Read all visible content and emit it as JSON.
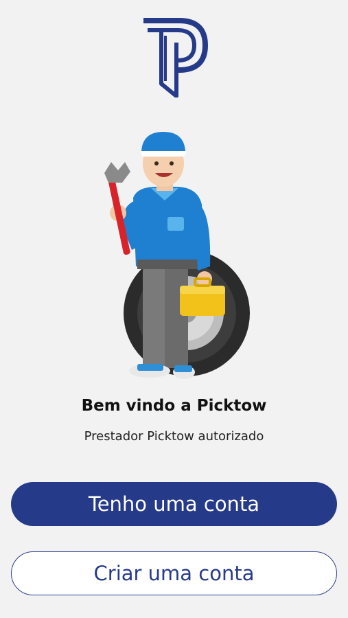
{
  "brand": {
    "logo_icon": "picktow-p-logo-icon",
    "color_primary": "#263a8a"
  },
  "hero": {
    "illustration": "mechanic-with-wrench-and-toolbox-illustration"
  },
  "welcome": {
    "title": "Bem vindo a Picktow",
    "subtitle": "Prestador Picktow autorizado"
  },
  "actions": {
    "login_label": "Tenho uma conta",
    "signup_label": "Criar uma conta"
  }
}
